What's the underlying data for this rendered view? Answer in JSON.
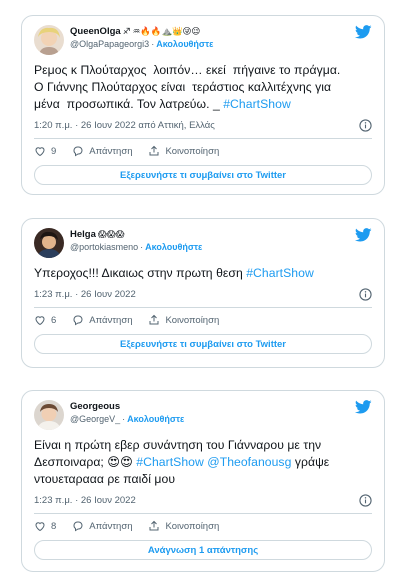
{
  "tweets": [
    {
      "name": "QueenOlga",
      "emojis": "♐ ♒🔥🔥⛰️👑😜😉",
      "handle": "@OlgaPapageorgi3",
      "follow": "Ακολουθήστε",
      "text_plain": "Ρεμος κ Πλούταρχος  λοιπόν… εκεί  πήγαινε το πράγμα.\nΟ Γιάννης Πλούταρχος είναι  τεράστιος καλλιτέχνης για\nμένα  προσωπικά. Τον λατρεύω. _ ",
      "hashtag": "#ChartShow",
      "text_after": "",
      "meta": "1:20 π.μ. · 26 Ιουν 2022 από Αττική, Ελλάς",
      "likes": "9",
      "reply_label": "Απάντηση",
      "share_label": "Κοινοποίηση",
      "cta": "Εξερευνήστε τι συμβαίνει στο Twitter"
    },
    {
      "name": "Helga",
      "emojis": "😱😱😱",
      "handle": "@portokiasmeno",
      "follow": "Ακολουθήστε",
      "text_plain": "Υπεροχος!!! Δικαιως στην πρωτη θεση ",
      "hashtag": "#ChartShow",
      "text_after": "",
      "meta": "1:23 π.μ. · 26 Ιουν 2022",
      "likes": "6",
      "reply_label": "Απάντηση",
      "share_label": "Κοινοποίηση",
      "cta": "Εξερευνήστε τι συμβαίνει στο Twitter"
    },
    {
      "name": "Georgeous",
      "emojis": "",
      "handle": "@GeorgeV_",
      "follow": "Ακολουθήστε",
      "text_plain": "Είναι η πρώτη εβερ συνάντηση του Γιάνναρου με την\nΔεσποιναρα; 😍😍 ",
      "hashtag": "#ChartShow",
      "mention": "@Theofanousg",
      "text_after": " γράψε\nντουεταρααα ρε παιδί μου",
      "meta": "1:23 π.μ. · 26 Ιουν 2022",
      "likes": "8",
      "reply_label": "Απάντηση",
      "share_label": "Κοινοποίηση",
      "cta": "Ανάγνωση 1 απάντησης"
    }
  ],
  "colors": {
    "accent": "#1d9bf0",
    "muted": "#536471",
    "border": "#cfd9de"
  },
  "icons": [
    "twitter-bird-icon",
    "info-icon",
    "heart-icon",
    "reply-icon",
    "share-icon"
  ]
}
